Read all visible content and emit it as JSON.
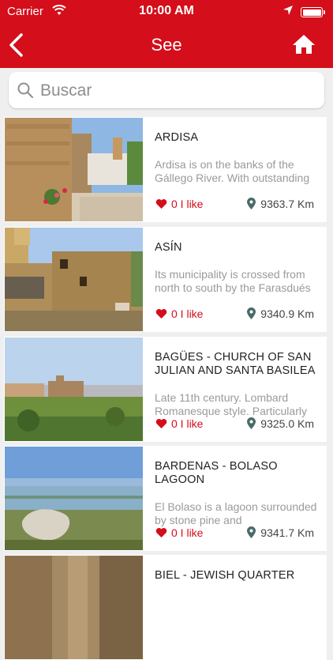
{
  "status": {
    "carrier": "Carrier",
    "time": "10:00 AM"
  },
  "header": {
    "title": "See",
    "back_icon": "chevron-left",
    "home_icon": "home"
  },
  "search": {
    "placeholder": "Buscar",
    "value": ""
  },
  "colors": {
    "brand": "#d40e1a",
    "like": "#d40e1a",
    "pin": "#4a6a6a"
  },
  "places": [
    {
      "title": "ARDISA",
      "description": "Ardisa is on the banks of the Gállego River. With outstanding",
      "likes": "0 I like",
      "distance": "9363.7 Km"
    },
    {
      "title": "ASÍN",
      "description": "Its municipality is crossed from north to south by the Farasdués",
      "likes": "0 I like",
      "distance": "9340.9 Km"
    },
    {
      "title": "BAGÜES - CHURCH OF SAN JULIAN AND SANTA BASILEA",
      "description": "Late 11th century. Lombard Romanesque style. Particularly",
      "likes": "0 I like",
      "distance": "9325.0 Km"
    },
    {
      "title": "BARDENAS - BOLASO LAGOON",
      "description": "El Bolaso is a lagoon surrounded by stone pine and",
      "likes": "0 I like",
      "distance": "9341.7 Km"
    },
    {
      "title": "BIEL - JEWISH QUARTER",
      "description": "",
      "likes": "",
      "distance": ""
    }
  ]
}
